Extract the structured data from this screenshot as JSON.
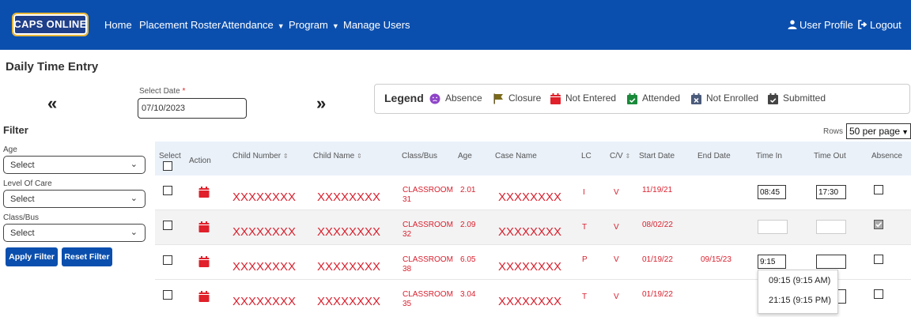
{
  "nav": {
    "logo": "CAPS ONLINE",
    "items": [
      {
        "label": "Home"
      },
      {
        "label": "Placement Roster"
      },
      {
        "label": "Attendance"
      },
      {
        "label": "Program"
      },
      {
        "label": "Manage Users"
      }
    ],
    "user_profile": "User Profile",
    "logout": "Logout"
  },
  "page_title": "Daily Time Entry",
  "date_nav": {
    "prev": "«",
    "next": "»",
    "select_date_label": "Select Date",
    "required_mark": "*",
    "date_value": "07/10/2023"
  },
  "legend": {
    "title": "Legend",
    "items": [
      {
        "label": "Absence",
        "icon": "absence-face-icon",
        "color": "#8e44c8"
      },
      {
        "label": "Closure",
        "icon": "closure-flag-icon",
        "color": "#7a6a1a"
      },
      {
        "label": "Not Entered",
        "icon": "not-entered-calendar-icon",
        "color": "#e0202a"
      },
      {
        "label": "Attended",
        "icon": "attended-calendar-icon",
        "color": "#1a8a3a"
      },
      {
        "label": "Not Enrolled",
        "icon": "not-enrolled-calendar-icon",
        "color": "#4a5a7a"
      },
      {
        "label": "Submitted",
        "icon": "submitted-calendar-icon",
        "color": "#444444"
      }
    ]
  },
  "filter": {
    "title": "Filter",
    "fields": [
      {
        "label": "Age",
        "value": "Select"
      },
      {
        "label": "Level Of Care",
        "value": "Select"
      },
      {
        "label": "Class/Bus",
        "value": "Select"
      }
    ],
    "apply": "Apply Filter",
    "reset": "Reset Filter"
  },
  "rows_control": {
    "label": "Rows",
    "value": "50 per page"
  },
  "table": {
    "headers": {
      "select": "Select",
      "action": "Action",
      "child_number": "Child Number",
      "child_name": "Child Name",
      "class_bus": "Class/Bus",
      "age": "Age",
      "case_name": "Case Name",
      "lc": "LC",
      "cv": "C/V",
      "start_date": "Start Date",
      "end_date": "End Date",
      "time_in": "Time In",
      "time_out": "Time Out",
      "absence": "Absence"
    },
    "rows": [
      {
        "child_number": "XXXXXXXX",
        "child_name": "XXXXXXXX",
        "class_line1": "CLASSROOM",
        "class_line2": "31",
        "age": "2.01",
        "case_name": "XXXXXXXX",
        "lc": "I",
        "cv": "V",
        "start_date": "11/19/21",
        "end_date": "",
        "time_in": "08:45",
        "time_out": "17:30",
        "absence_checked": false
      },
      {
        "child_number": "XXXXXXXX",
        "child_name": "XXXXXXXX",
        "class_line1": "CLASSROOM",
        "class_line2": "32",
        "age": "2.09",
        "case_name": "XXXXXXXX",
        "lc": "T",
        "cv": "V",
        "start_date": "08/02/22",
        "end_date": "",
        "time_in": "",
        "time_out": "",
        "absence_checked": true
      },
      {
        "child_number": "XXXXXXXX",
        "child_name": "XXXXXXXX",
        "class_line1": "CLASSROOM",
        "class_line2": "38",
        "age": "6.05",
        "case_name": "XXXXXXXX",
        "lc": "P",
        "cv": "V",
        "start_date": "01/19/22",
        "end_date": "09/15/23",
        "time_in": "9:15",
        "time_out": "",
        "absence_checked": false
      },
      {
        "child_number": "XXXXXXXX",
        "child_name": "XXXXXXXX",
        "class_line1": "CLASSROOM",
        "class_line2": "35",
        "age": "3.04",
        "case_name": "XXXXXXXX",
        "lc": "T",
        "cv": "V",
        "start_date": "01/19/22",
        "end_date": "",
        "time_in": "",
        "time_out": "",
        "absence_checked": false
      }
    ]
  },
  "time_suggestions": [
    "09:15 (9:15 AM)",
    "21:15 (9:15 PM)"
  ],
  "colors": {
    "nav_bg": "#0b4fae",
    "row_text": "#d9212f",
    "header_bg": "#eaf1f9"
  }
}
